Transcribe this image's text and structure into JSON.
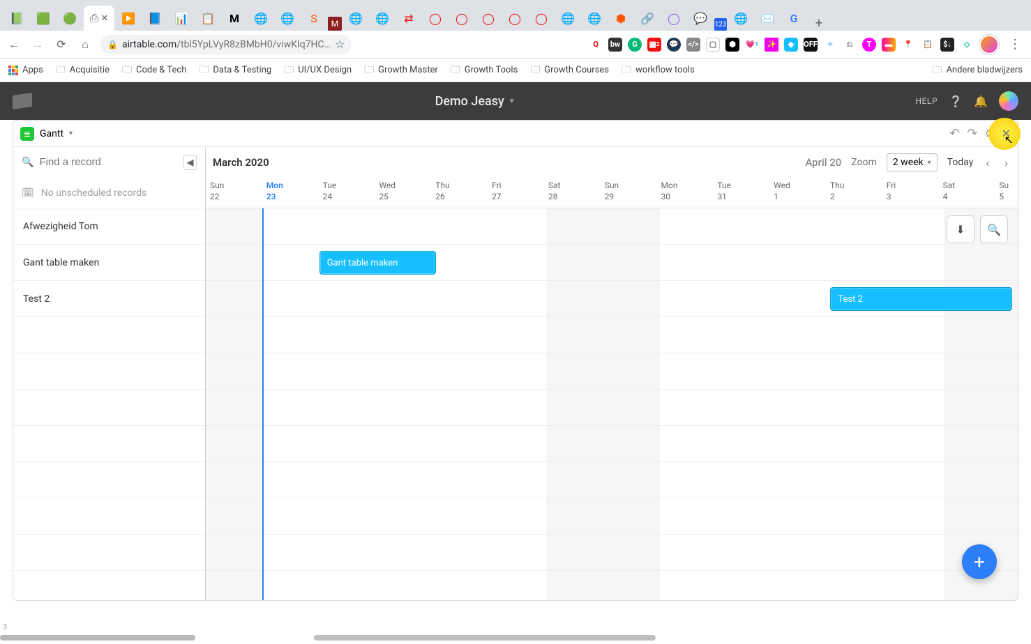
{
  "browser": {
    "url_domain": "airtable.com",
    "url_path": "/tbl5YpLVyR8zBMbH0/viwKIq7HC…",
    "bookmarks": {
      "apps": "Apps",
      "folders": [
        "Acquisitie",
        "Code & Tech",
        "Data & Testing",
        "UI/UX Design",
        "Growth Master",
        "Growth Tools",
        "Growth Courses",
        "workflow tools"
      ],
      "overflow": "Andere bladwijzers"
    }
  },
  "appHeader": {
    "title": "Demo Jeasy",
    "help": "HELP"
  },
  "viewBar": {
    "viewName": "Gantt"
  },
  "leftPane": {
    "searchPlaceholder": "Find a record",
    "unscheduled": "No unscheduled records",
    "records": [
      "Afwezigheid Tom",
      "Gant table maken",
      "Test 2"
    ]
  },
  "timeline": {
    "monthPrimary": "March 2020",
    "monthSecondary": "April 20",
    "zoomLabel": "Zoom",
    "zoomValue": "2 week",
    "todayLabel": "Today",
    "days": [
      {
        "name": "Sun",
        "num": "22",
        "weekend": true
      },
      {
        "name": "Mon",
        "num": "23",
        "today": true
      },
      {
        "name": "Tue",
        "num": "24"
      },
      {
        "name": "Wed",
        "num": "25"
      },
      {
        "name": "Thu",
        "num": "26"
      },
      {
        "name": "Fri",
        "num": "27"
      },
      {
        "name": "Sat",
        "num": "28",
        "weekend": true
      },
      {
        "name": "Sun",
        "num": "29",
        "weekend": true
      },
      {
        "name": "Mon",
        "num": "30"
      },
      {
        "name": "Tue",
        "num": "31"
      },
      {
        "name": "Wed",
        "num": "1"
      },
      {
        "name": "Thu",
        "num": "2"
      },
      {
        "name": "Fri",
        "num": "3"
      },
      {
        "name": "Sat",
        "num": "4",
        "weekend": true
      },
      {
        "name": "Su",
        "num": "5",
        "weekend": true,
        "clip": true
      }
    ],
    "bars": [
      {
        "row": 1,
        "label": "Gant table maken",
        "startCol": 2,
        "span": 2.05
      },
      {
        "row": 2,
        "label": "Test 2",
        "startCol": 11,
        "span": 3.2
      }
    ]
  },
  "statusNum": "3"
}
